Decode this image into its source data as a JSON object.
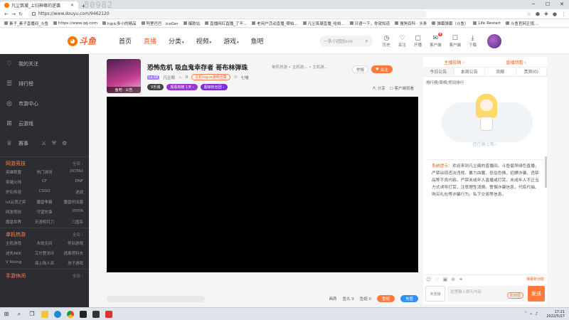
{
  "browser": {
    "tab_title": "凡尘筑凝_上归神尊的逆袭",
    "ghost_text": "80982",
    "url": "https://www.douyu.com/9462120",
    "bookmarks": [
      "素子_素子直播间_斗鱼",
      "https://www.qq.com",
      "hipic多小的精品",
      "阿里巴巴 · iceGer",
      "爆款站",
      "直播网红直播_了不...",
      "老用户活动直播_哪拍...",
      "凡尘筑凝直播_哈拍...",
      "日语一下，你就知道",
      "搜狗百科 · 头条",
      "弹幕弹幕（斗鱼）",
      "Life Restart",
      "斗鱼官网正规..."
    ]
  },
  "site": {
    "logo_text": "斗鱼",
    "nav": [
      "首页",
      "直播",
      "分类",
      "视频",
      "游戏",
      "鱼吧"
    ],
    "active_nav": "直播",
    "search_placeholder": "一条小团团ovo",
    "tools": [
      {
        "icon": "history-icon",
        "glyph": "◷",
        "label": "历史"
      },
      {
        "icon": "heart-icon",
        "glyph": "♡",
        "label": "关注"
      },
      {
        "icon": "broadcast-icon",
        "glyph": "▢",
        "label": "开播"
      },
      {
        "icon": "message-icon",
        "glyph": "✉",
        "label": "客户端",
        "badge": "8"
      },
      {
        "icon": "phone-icon",
        "glyph": "☐",
        "label": "客户端"
      },
      {
        "icon": "download-icon",
        "glyph": "⤓",
        "label": "下载"
      }
    ]
  },
  "sidebar": {
    "top_items": [
      {
        "icon": "heart-icon",
        "glyph": "♡",
        "label": "我的关注"
      },
      {
        "icon": "list-icon",
        "glyph": "☰",
        "label": "排行榜"
      },
      {
        "icon": "compass-icon",
        "glyph": "◎",
        "label": "市游中心"
      },
      {
        "icon": "gamepad-icon",
        "glyph": "⊞",
        "label": "云游戏"
      },
      {
        "icon": "trophy-icon",
        "glyph": "♕",
        "label": "赛事"
      }
    ],
    "sections": [
      {
        "title": "网游竞技",
        "more": "全部 ›",
        "items": [
          "英雄联盟",
          "热门游戏",
          "DOTA2",
          "穿越火线",
          "CF",
          "DNF",
          "炉石传说",
          "CSGO",
          "逆战",
          "lol云顶之弈",
          "魔兽争霸",
          "魔兽怀旧服",
          "网游竞技",
          "守望先锋",
          "DOTA",
          "魔兽世界",
          "天涯明月刀",
          "三国杀"
        ]
      },
      {
        "title": "单机热游",
        "more": "全部 ›",
        "items": [
          "主机游戏",
          "永劫无间",
          "怀旧游戏",
          "迷失ARK",
          "艾尔登法环",
          "逃离塔科夫",
          "V Rising",
          "海上陆人杀",
          "孩子游戏"
        ]
      },
      {
        "title": "手游休闲",
        "more": "全部 ›",
        "items": []
      }
    ]
  },
  "room": {
    "avatar_caption": "鱼吧 · 公告",
    "title": "恐怖危机 吸血鬼幸存者 哥布林弹珠",
    "category": "单机热游 • 主机游... • 主机游...",
    "level": "Lv.16",
    "anchor_name": "凡尘阁",
    "hot": "0",
    "tag": "主机rogue游戏合集",
    "fans": "七喵",
    "badges": [
      "V乐城",
      "观看热榜 1天 ›",
      "超级粉丝团 ›"
    ],
    "report_label": "举报",
    "follow_label": "关注",
    "share_label": "分享",
    "client_label": "客户端观看"
  },
  "player_bar": {
    "quality": "画质",
    "fish_ball": "鱼丸 9",
    "fin": "鱼翅 0",
    "btn_gift": "鱼翅",
    "btn_charge": "充值"
  },
  "rpanel": {
    "top_links": [
      "主播投稿 ›",
      "直播回看 ›"
    ],
    "tabs": [
      "今日公告",
      "本周公告",
      "贡献",
      "贵宾(0)"
    ],
    "active_tab": "今日公告",
    "sub": "排行榜/周榜/房间排行",
    "illu_text": "还在路上哦~",
    "notice_label": "系统提示：",
    "notice_text": "欢迎来到凡尘阁的直播间。斗鱼倡导绿色直播，严禁出现违法违规、暴力血腥、低俗色情、招嫖诈骗、违禁品等不良内容。严禁未成年人直播或打赏。未成年人不正当方式诱导打赏，注意理性消费。警惕诈骗信息，代练代抽、购买礼包等诈骗行为，私下交易等信息。",
    "chat_tools_right": "弹幕新功能",
    "chat_badge": "未连接",
    "chat_placeholder": "这里输入聊天内容",
    "gift_label": "粉丝团",
    "send_label": "发送"
  },
  "taskbar": {
    "time": "17:21",
    "date": "2022/5/27"
  }
}
